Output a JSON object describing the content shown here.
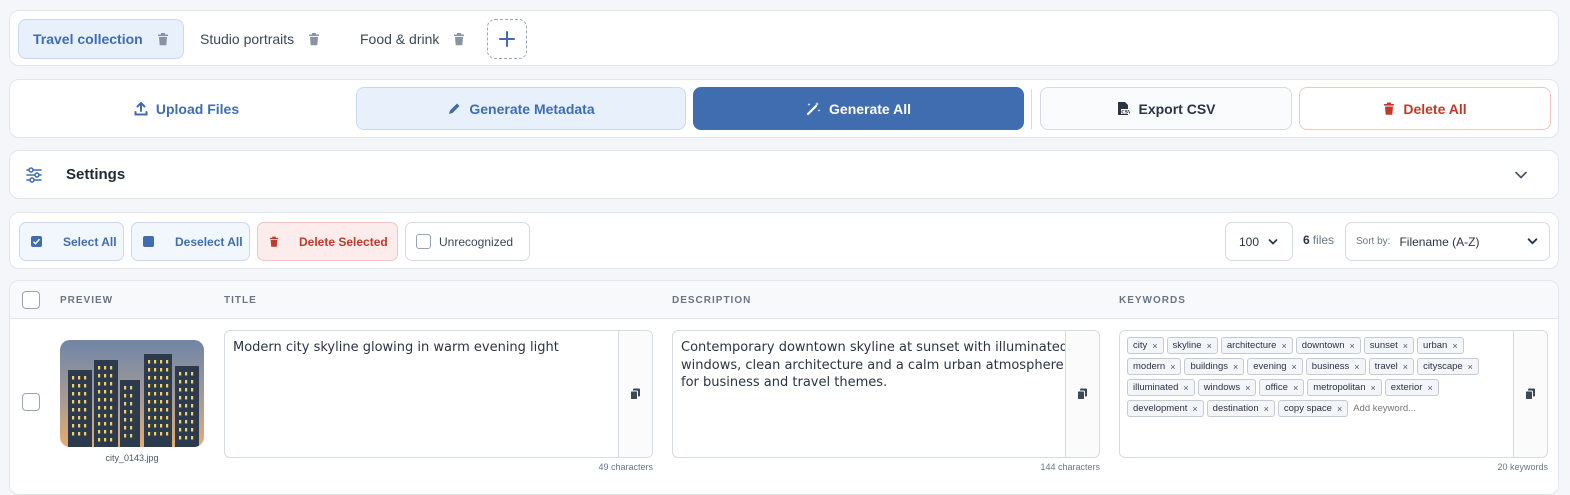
{
  "tabs": [
    {
      "label": "Travel collection"
    },
    {
      "label": "Studio portraits"
    },
    {
      "label": "Food & drink"
    }
  ],
  "actions": {
    "upload": "Upload Files",
    "generate_metadata": "Generate Metadata",
    "generate_all": "Generate All",
    "export": "Export CSV",
    "delete_all": "Delete All"
  },
  "settings": {
    "label": "Settings"
  },
  "toolbar": {
    "select_all": "Select All",
    "deselect_all": "Deselect All",
    "delete_selected": "Delete Selected",
    "unrecognized": "Unrecognized",
    "page_size": "100",
    "file_count": "6",
    "files_label": "files",
    "sort_label": "Sort by:",
    "sort_value": "Filename (A-Z)"
  },
  "table": {
    "headers": {
      "preview": "PREVIEW",
      "title": "TITLE",
      "description": "DESCRIPTION",
      "keywords": "KEYWORDS"
    },
    "rows": [
      {
        "filename": "city_0143.jpg",
        "title": "Modern city skyline glowing in warm evening light",
        "title_count": "49 characters",
        "description": "Contemporary downtown skyline at sunset with illuminated\nwindows, clean architecture and a calm urban atmosphere\nfor business and travel themes.",
        "description_count": "144 characters",
        "keywords": [
          "city",
          "skyline",
          "architecture",
          "downtown",
          "sunset",
          "urban",
          "modern",
          "buildings",
          "evening",
          "business",
          "travel",
          "cityscape",
          "illuminated",
          "windows",
          "office",
          "metropolitan",
          "exterior",
          "development",
          "destination",
          "copy space"
        ],
        "keyword_placeholder": "Add keyword...",
        "keywords_count": "20 keywords"
      }
    ]
  },
  "colors": {
    "accent": "#3f6db0",
    "accent_light": "#e8f0fb",
    "danger": "#c0392b",
    "danger_light": "#fdecec"
  }
}
